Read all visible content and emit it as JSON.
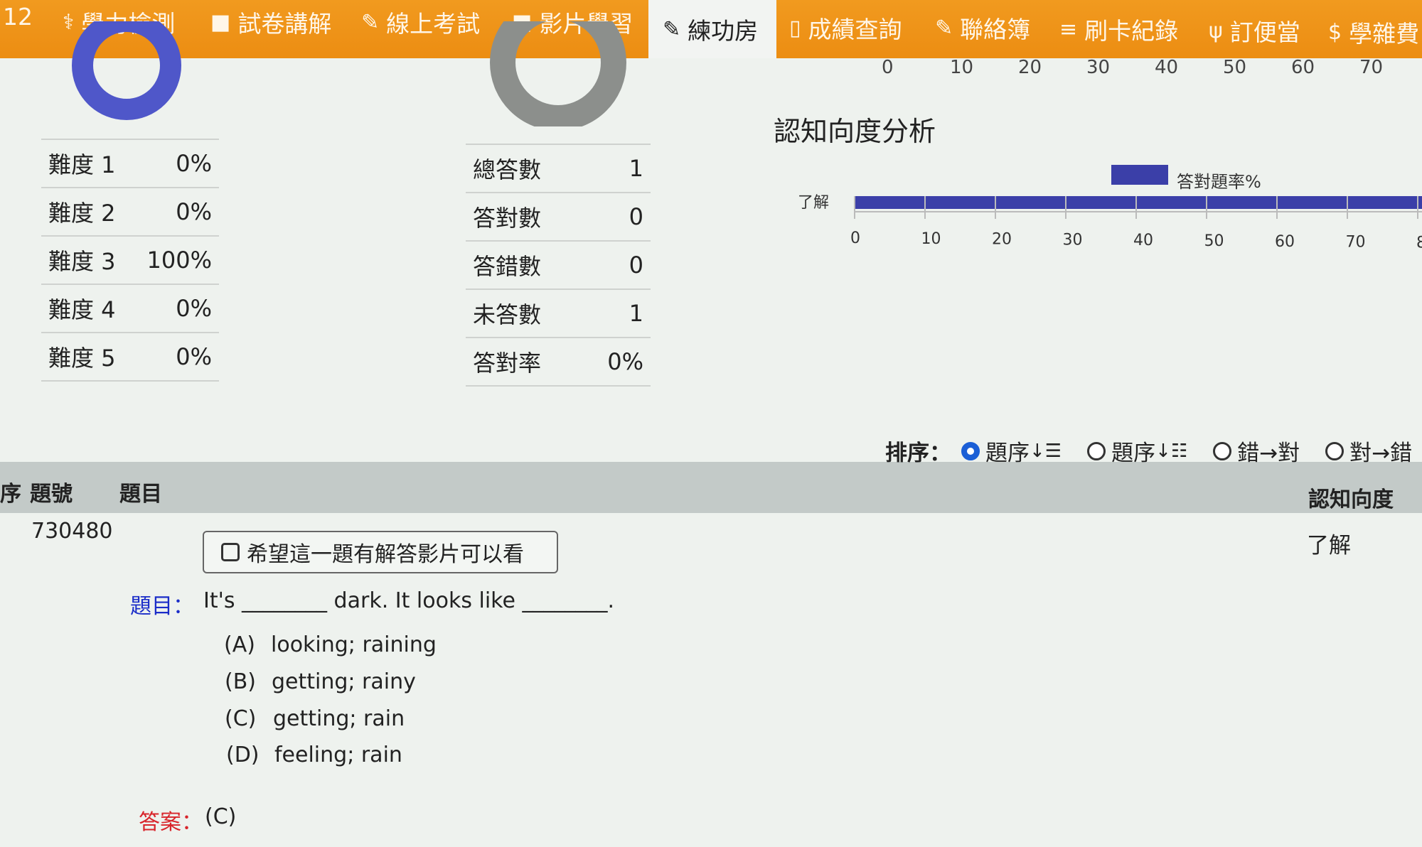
{
  "nav": {
    "partial_num": "12",
    "items": [
      {
        "icon": "stethoscope-icon",
        "glyph": "⚕",
        "label": "學力檢測"
      },
      {
        "icon": "video-icon",
        "glyph": "■",
        "label": "試卷講解"
      },
      {
        "icon": "pencil-icon",
        "glyph": "✎",
        "label": "線上考試"
      },
      {
        "icon": "video-icon",
        "glyph": "■",
        "label": "影片學習"
      },
      {
        "icon": "edit-icon",
        "glyph": "✎",
        "label": "練功房"
      },
      {
        "icon": "file-icon",
        "glyph": "▯",
        "label": "成績查詢"
      },
      {
        "icon": "edit-icon",
        "glyph": "✎",
        "label": "聯絡簿"
      },
      {
        "icon": "list-icon",
        "glyph": "≡",
        "label": "刷卡紀錄"
      },
      {
        "icon": "cutlery-icon",
        "glyph": "ψ",
        "label": "訂便當"
      },
      {
        "icon": "dollar-icon",
        "glyph": "$",
        "label": "學雜費"
      }
    ]
  },
  "difficulty_table": [
    {
      "label": "難度 1",
      "value": "0%"
    },
    {
      "label": "難度 2",
      "value": "0%"
    },
    {
      "label": "難度 3",
      "value": "100%"
    },
    {
      "label": "難度 4",
      "value": "0%"
    },
    {
      "label": "難度 5",
      "value": "0%"
    }
  ],
  "answer_table": [
    {
      "label": "總答數",
      "value": "1"
    },
    {
      "label": "答對數",
      "value": "0"
    },
    {
      "label": "答錯數",
      "value": "0"
    },
    {
      "label": "未答數",
      "value": "1"
    },
    {
      "label": "答對率",
      "value": "0%"
    }
  ],
  "top_axis_ticks": [
    "0",
    "10",
    "20",
    "30",
    "40",
    "50",
    "60",
    "70"
  ],
  "chart_data": {
    "type": "bar",
    "title": "認知向度分析",
    "categories": [
      "了解"
    ],
    "series": [
      {
        "name": "答對題率%",
        "values": [
          100
        ]
      }
    ],
    "xticks": [
      "0",
      "10",
      "20",
      "30",
      "40",
      "50",
      "60",
      "70",
      "8"
    ],
    "xlim": [
      0,
      80
    ],
    "legend": "top",
    "bar_color": "#3b3fa8"
  },
  "sort": {
    "label": "排序：",
    "options": [
      {
        "label": "題序",
        "glyph": "↓☰",
        "checked": true
      },
      {
        "label": "題序",
        "glyph": "↓☷",
        "checked": false
      },
      {
        "label": "錯→對",
        "glyph": "",
        "checked": false
      },
      {
        "label": "對→錯",
        "glyph": "",
        "checked": false
      }
    ]
  },
  "table_header": {
    "col0": "序",
    "col1": "題號",
    "col2": "題目",
    "col3": "認知向度"
  },
  "question": {
    "id": "730480",
    "cognitive": "了解",
    "video_request": "希望這一題有解答影片可以看",
    "label": "題目：",
    "text": "It's ________ dark. It looks like ________.",
    "options": [
      {
        "key": "(A)",
        "text": "looking; raining"
      },
      {
        "key": "(B)",
        "text": "getting; rainy"
      },
      {
        "key": "(C)",
        "text": "getting; rain"
      },
      {
        "key": "(D)",
        "text": "feeling; rain"
      }
    ],
    "answer_label": "答案：",
    "answer": "(C)"
  }
}
